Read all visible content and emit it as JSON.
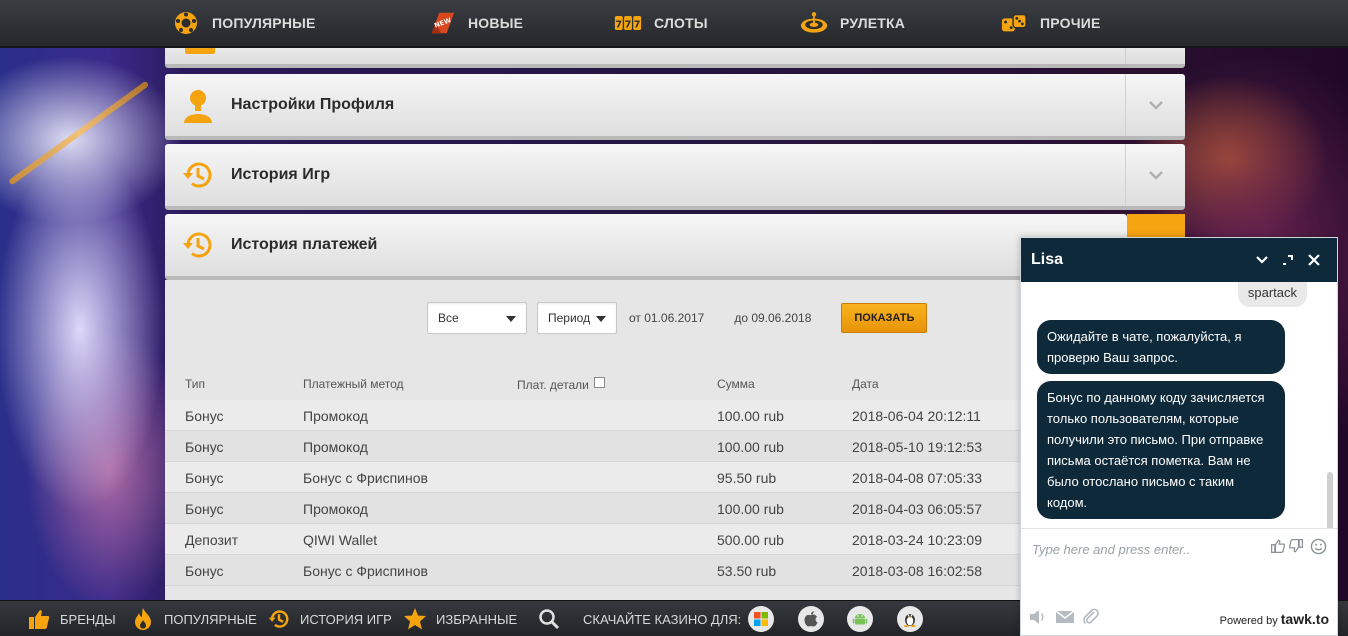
{
  "topnav": {
    "items": [
      {
        "label": "ПОПУЛЯРНЫЕ",
        "icon": "football-icon"
      },
      {
        "label": "НОВЫЕ",
        "icon": "new-badge-icon"
      },
      {
        "label": "СЛОТЫ",
        "icon": "slots-777-icon"
      },
      {
        "label": "РУЛЕТКА",
        "icon": "roulette-icon"
      },
      {
        "label": "ПРОЧИЕ",
        "icon": "dice-icon"
      }
    ]
  },
  "accordion": {
    "profile": "Настройки Профиля",
    "games_history": "История Игр",
    "payments_history": "История платежей"
  },
  "filters": {
    "type_select": "Все",
    "period_select": "Период",
    "from_label": "от 01.06.2017",
    "to_label": "до 09.06.2018",
    "show_button": "ПОКАЗАТЬ"
  },
  "table": {
    "headers": [
      "Тип",
      "Платежный метод",
      "Плат. детали",
      "Сумма",
      "Дата"
    ],
    "rows": [
      [
        "Бонус",
        "Промокод",
        "",
        "100.00 rub",
        "2018-06-04 20:12:11"
      ],
      [
        "Бонус",
        "Промокод",
        "",
        "100.00 rub",
        "2018-05-10 19:12:53"
      ],
      [
        "Бонус",
        "Бонус с Фриспинов",
        "",
        "95.50 rub",
        "2018-04-08 07:05:33"
      ],
      [
        "Бонус",
        "Промокод",
        "",
        "100.00 rub",
        "2018-04-03 06:05:57"
      ],
      [
        "Депозит",
        "QIWI Wallet",
        "",
        "500.00 rub",
        "2018-03-24 10:23:09"
      ],
      [
        "Бонус",
        "Бонус с Фриспинов",
        "",
        "53.50 rub",
        "2018-03-08 16:02:58"
      ]
    ]
  },
  "bottombar": {
    "brands": "БРЕНДЫ",
    "popular": "ПОПУЛЯРНЫЕ",
    "games_history": "ИСТОРИЯ ИГР",
    "favorites": "ИЗБРАННЫЕ",
    "download": "СКАЧАЙТЕ КАЗИНО ДЛЯ:"
  },
  "chat": {
    "agent_name": "Lisa",
    "user_message": "spartack",
    "agent_message_1": "Ожидайте в чате, пожалуйста, я проверю Ваш запрос.",
    "agent_message_2": "Бонус по данному коду зачисляется только пользователям, которые получили это письмо. При отправке письма остаётся пометка. Вам не было отослано письмо с таким кодом.",
    "input_placeholder": "Type here and press enter..",
    "powered_by": "Powered by",
    "brand": "tawk.to"
  },
  "colors": {
    "accent_orange": "#f5a40f",
    "chat_navy": "#0e2a3a"
  }
}
